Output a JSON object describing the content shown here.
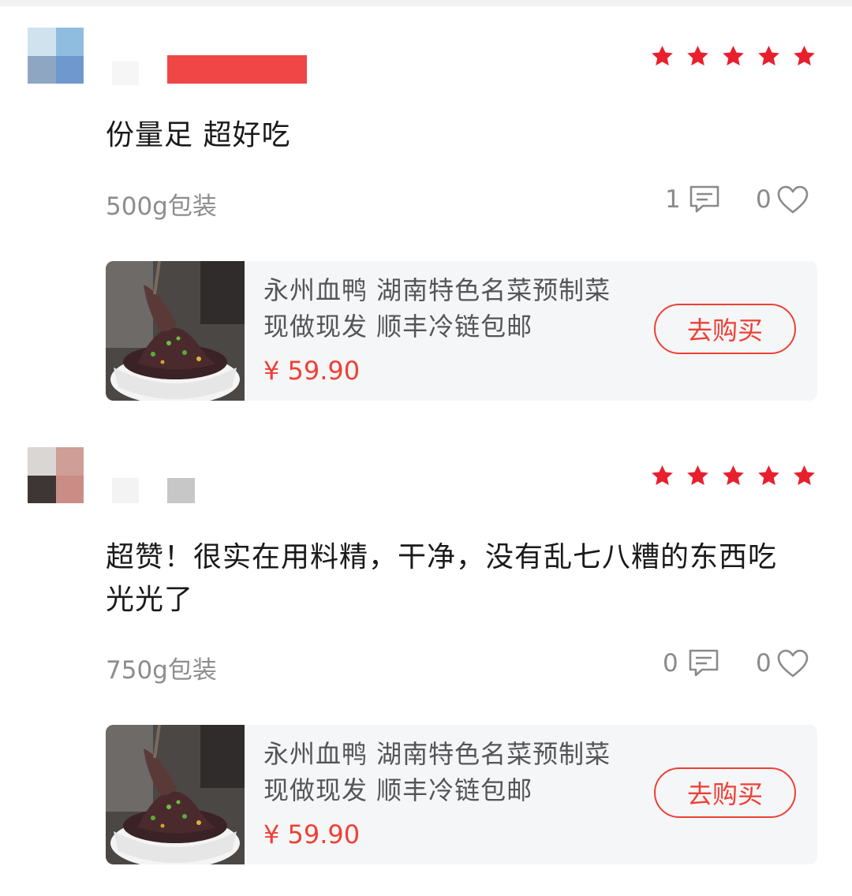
{
  "reviews": [
    {
      "text": "份量足 超好吃",
      "spec": "500g包装",
      "comment_count": "1",
      "like_count": "0",
      "rating": 5,
      "product": {
        "title": "永州血鸭 湖南特色名菜预制菜 现做现发 顺丰冷链包邮",
        "price": "¥ 59.90",
        "buy_label": "去购买"
      }
    },
    {
      "text": "超赞！很实在用料精，干净，没有乱七八糟的东西吃光光了",
      "spec": "750g包装",
      "comment_count": "0",
      "like_count": "0",
      "rating": 5,
      "product": {
        "title": "永州血鸭 湖南特色名菜预制菜 现做现发 顺丰冷链包邮",
        "price": "¥ 59.90",
        "buy_label": "去购买"
      }
    }
  ],
  "colors": {
    "accent": "#ee4035",
    "star": "#e8202e",
    "redacted": "#f04646"
  },
  "icons": {
    "comment": "comment-icon",
    "like": "heart-icon",
    "star": "star-icon"
  }
}
